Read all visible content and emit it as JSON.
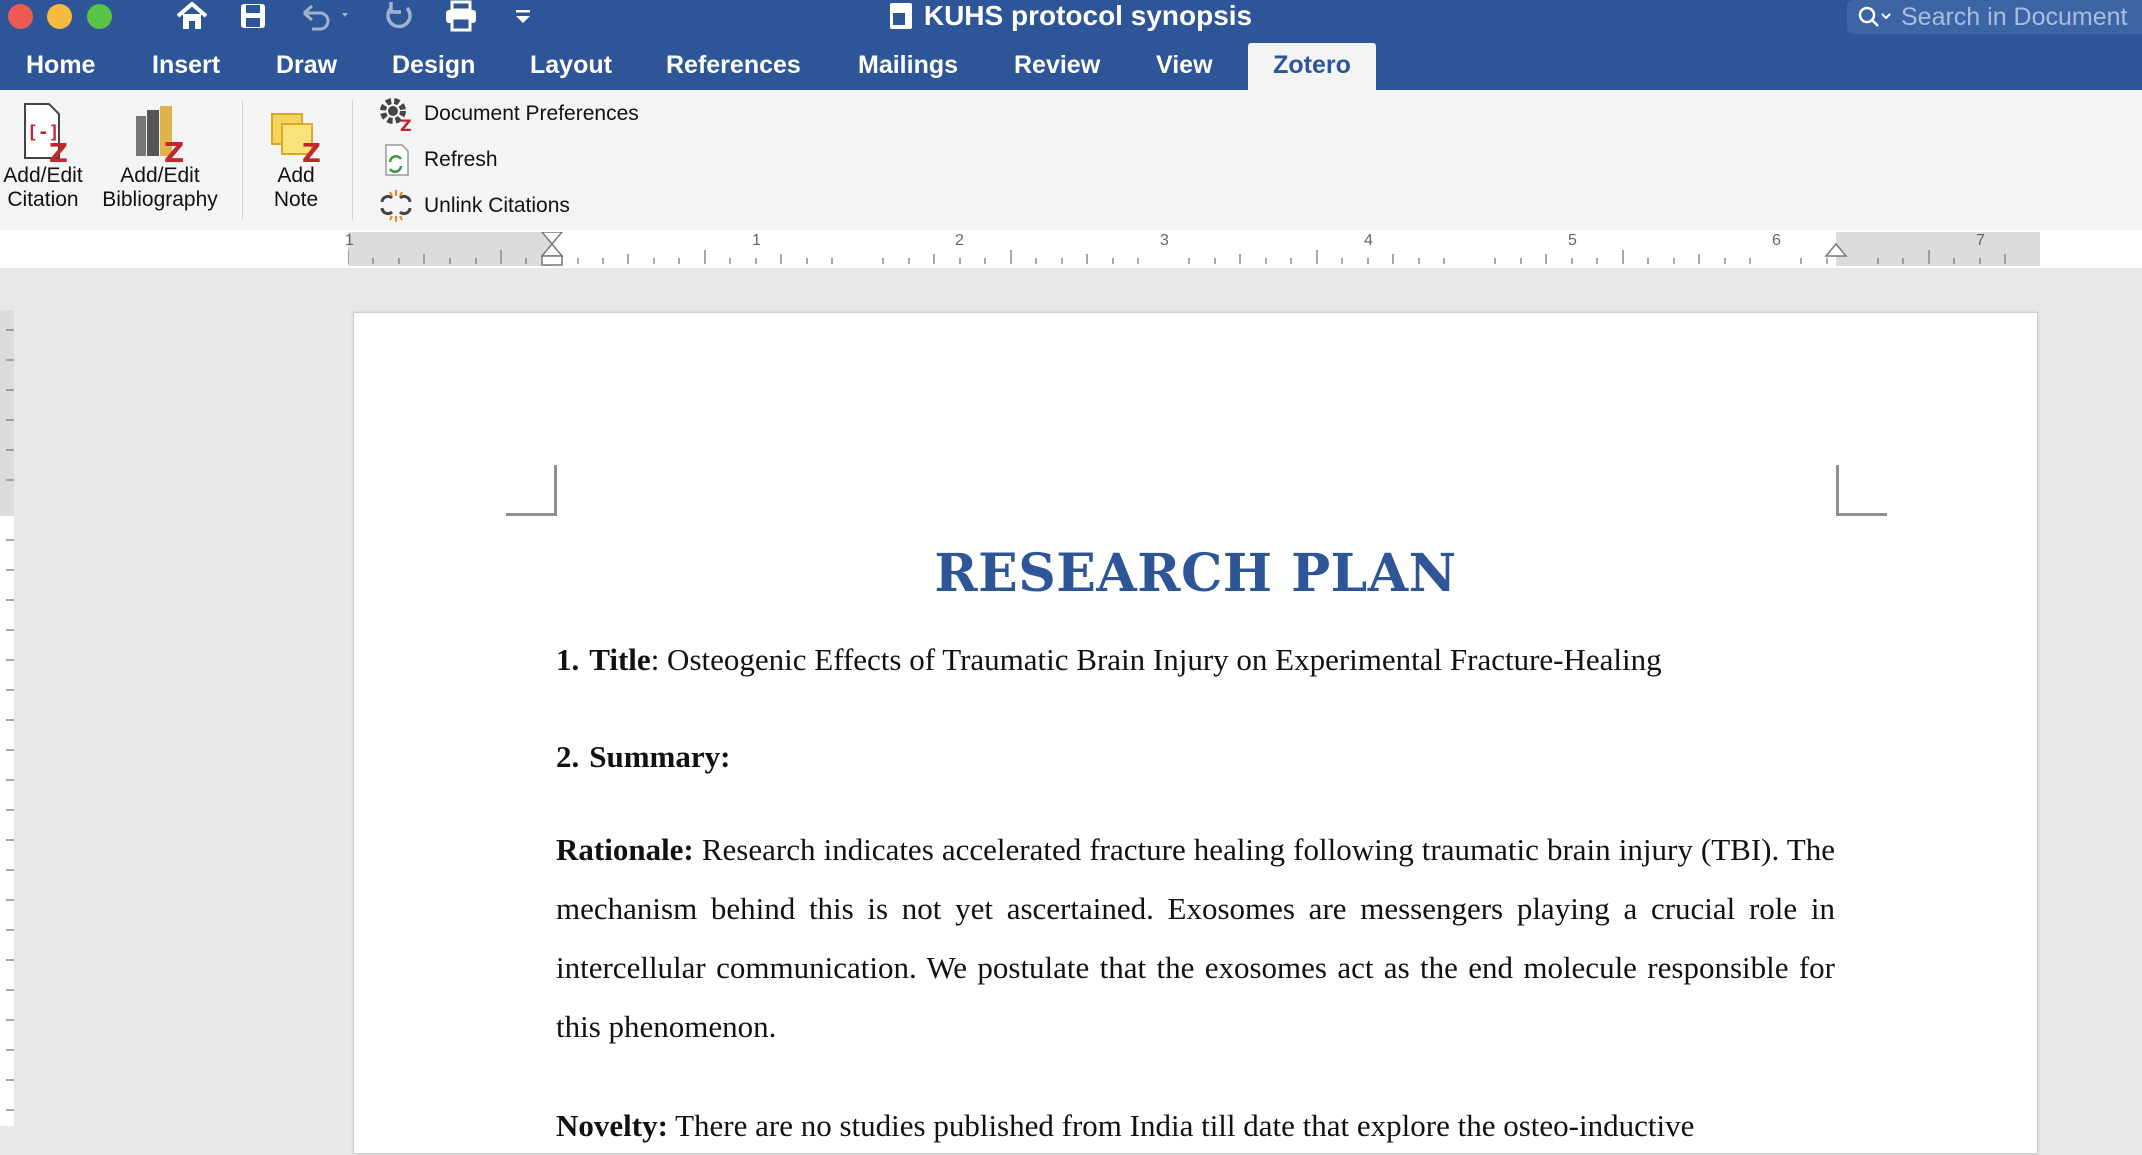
{
  "window": {
    "title": "KUHS protocol synopsis",
    "search_placeholder": "Search in Document"
  },
  "quick_access": [
    "home-icon",
    "save-icon",
    "undo-icon",
    "redo-icon",
    "print-icon",
    "customize-icon"
  ],
  "tabs": [
    {
      "label": "Home"
    },
    {
      "label": "Insert"
    },
    {
      "label": "Draw"
    },
    {
      "label": "Design"
    },
    {
      "label": "Layout"
    },
    {
      "label": "References"
    },
    {
      "label": "Mailings"
    },
    {
      "label": "Review"
    },
    {
      "label": "View"
    },
    {
      "label": "Zotero",
      "active": true
    }
  ],
  "ribbon": {
    "add_edit_citation": {
      "line1": "Add/Edit",
      "line2": "Citation"
    },
    "add_edit_bibliography": {
      "line1": "Add/Edit",
      "line2": "Bibliography"
    },
    "add_note": {
      "line1": "Add",
      "line2": "Note"
    },
    "document_preferences": "Document Preferences",
    "refresh": "Refresh",
    "unlink_citations": "Unlink Citations"
  },
  "ruler": {
    "numbers": [
      "1",
      "1",
      "2",
      "3",
      "4",
      "5",
      "6",
      "7"
    ]
  },
  "document": {
    "heading": "RESEARCH PLAN",
    "item1_number": "1.",
    "item1_label": "Title",
    "item1_text": ": Osteogenic Effects of Traumatic Brain Injury on Experimental Fracture-Healing",
    "item2_number": "2.",
    "item2_label": "Summary:",
    "rationale_label": "Rationale:",
    "rationale_text": " Research indicates accelerated fracture healing following traumatic brain injury (TBI). The mechanism behind this is not yet ascertained. Exosomes are messengers playing a crucial role in intercellular communication. We postulate that the exosomes act as the end molecule responsible for this phenomenon.",
    "novelty_label": "Novelty:",
    "novelty_text": " There are no studies published from India till date that explore the osteo-inductive"
  },
  "colors": {
    "titlebar": "#2e5597",
    "ribbon": "#f4f4f4",
    "heading": "#2e5597",
    "zotero_red": "#c1272d"
  }
}
